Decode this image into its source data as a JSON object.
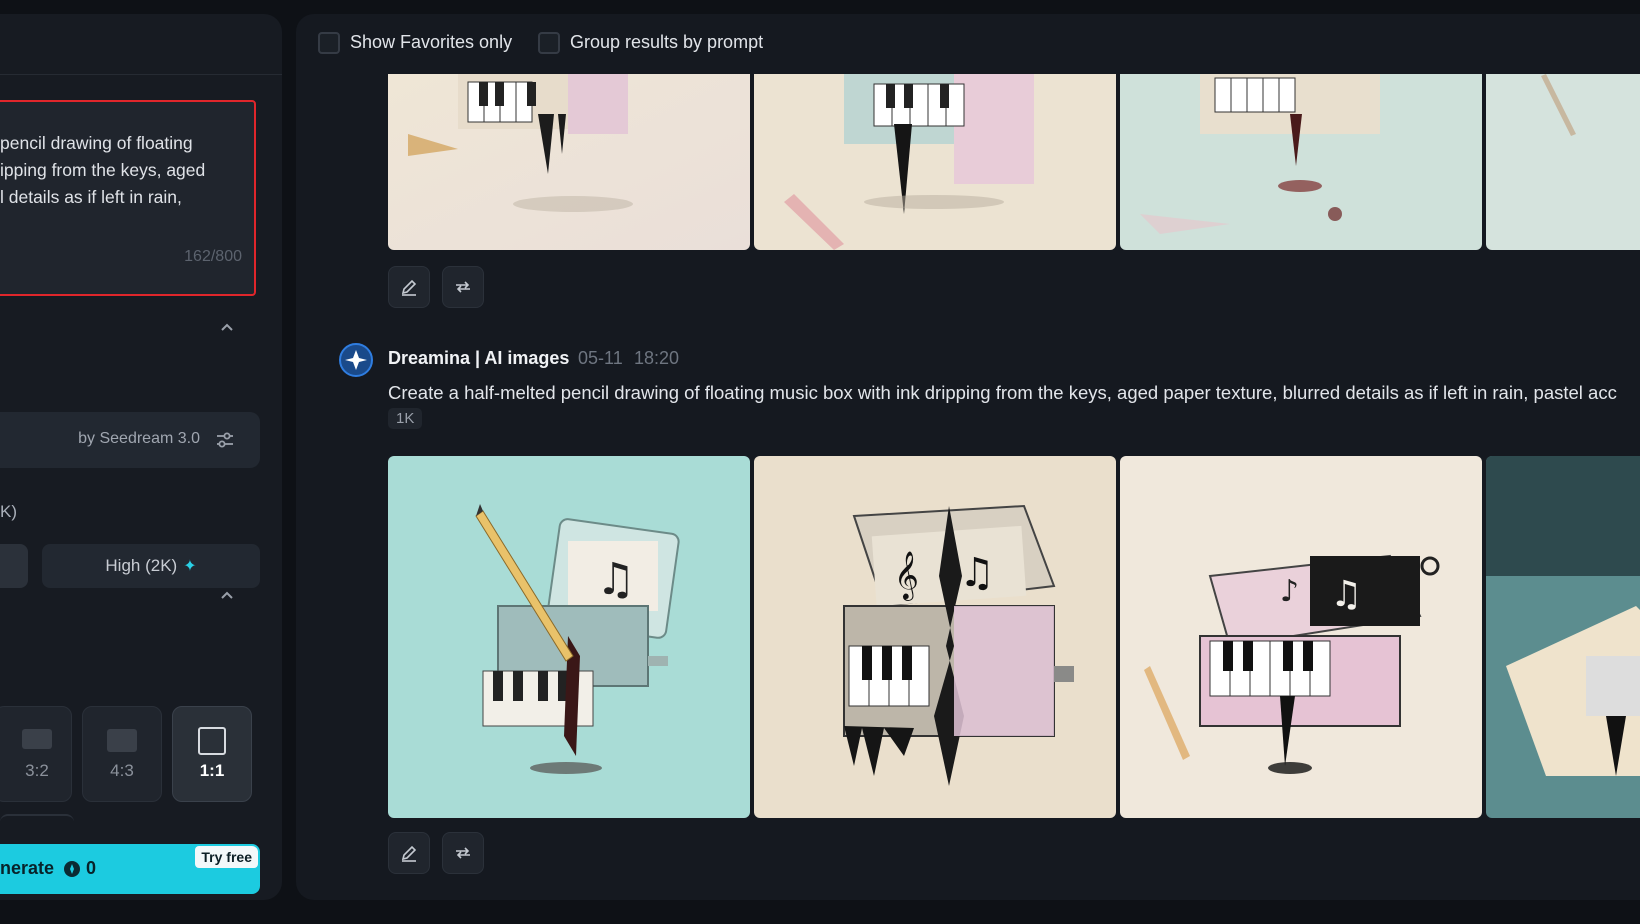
{
  "left_panel": {
    "prompt_text": "pencil drawing of floating\nipping from the keys, aged\nl details as if left in rain,",
    "prompt_count": "162/800",
    "model_label": "by Seedream 3.0",
    "resolution_label": "K)",
    "quality_high_label": "High (2K)",
    "ratios": [
      {
        "label": "3:2",
        "selected": false
      },
      {
        "label": "4:3",
        "selected": false
      },
      {
        "label": "1:1",
        "selected": true
      }
    ],
    "generate_label": "nerate",
    "generate_count": "0",
    "try_free_label": "Try free"
  },
  "toolbar": {
    "show_favorites_label": "Show Favorites only",
    "group_results_label": "Group results by prompt"
  },
  "feed": {
    "entry": {
      "author": "Dreamina | AI images",
      "date": "05-11",
      "time": "18:20",
      "prompt": "Create a half-melted pencil drawing of floating music box with ink dripping from the keys, aged paper texture, blurred details as if left in rain, pastel acc",
      "resolution_badge": "1K"
    }
  },
  "colors": {
    "accent": "#1ccbe0",
    "highlight_border": "#e0262b",
    "background": "#0e1116"
  }
}
